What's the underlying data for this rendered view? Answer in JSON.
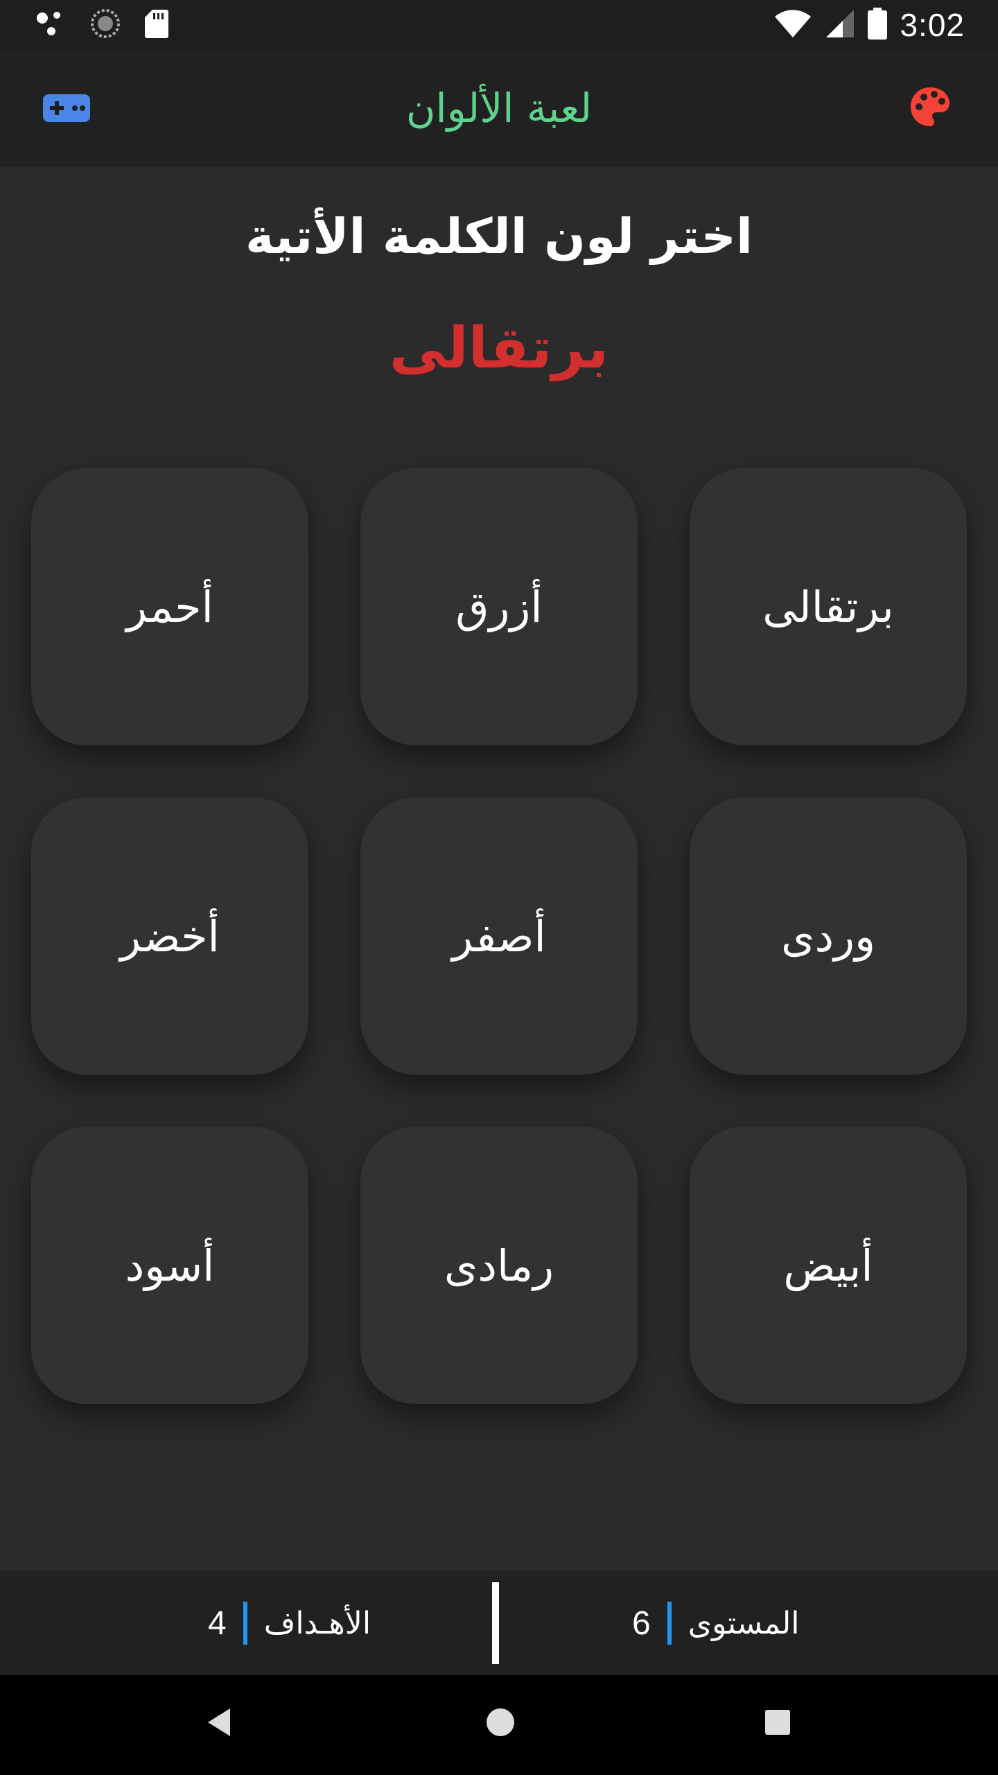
{
  "status_bar": {
    "time": "3:02",
    "icons": [
      "notification-dots-icon",
      "sync-icon",
      "sd-card-icon",
      "wifi-icon",
      "signal-icon",
      "battery-icon"
    ]
  },
  "app_bar": {
    "title": "لعبة الألوان",
    "left_icon": "gamepad-icon",
    "right_icon": "palette-icon"
  },
  "prompt": {
    "instruction": "اختر لون الكلمة الأتية",
    "word": "برتقالى"
  },
  "choices": [
    {
      "label": "برتقالى"
    },
    {
      "label": "أزرق"
    },
    {
      "label": "أحمر"
    },
    {
      "label": "وردى"
    },
    {
      "label": "أصفر"
    },
    {
      "label": "أخضر"
    },
    {
      "label": "أبيض"
    },
    {
      "label": "رمادى"
    },
    {
      "label": "أسود"
    }
  ],
  "footer": {
    "level_label": "المستوى",
    "level_value": "6",
    "score_label": "الأهـداف",
    "score_value": "4"
  },
  "nav": [
    "back-icon",
    "home-icon",
    "recents-icon"
  ],
  "colors": {
    "title": "#5fd38d",
    "target_word": "#d32f2f",
    "gamepad": "#4a86e8",
    "palette": "#f44336",
    "stat_accent": "#2196f3"
  }
}
